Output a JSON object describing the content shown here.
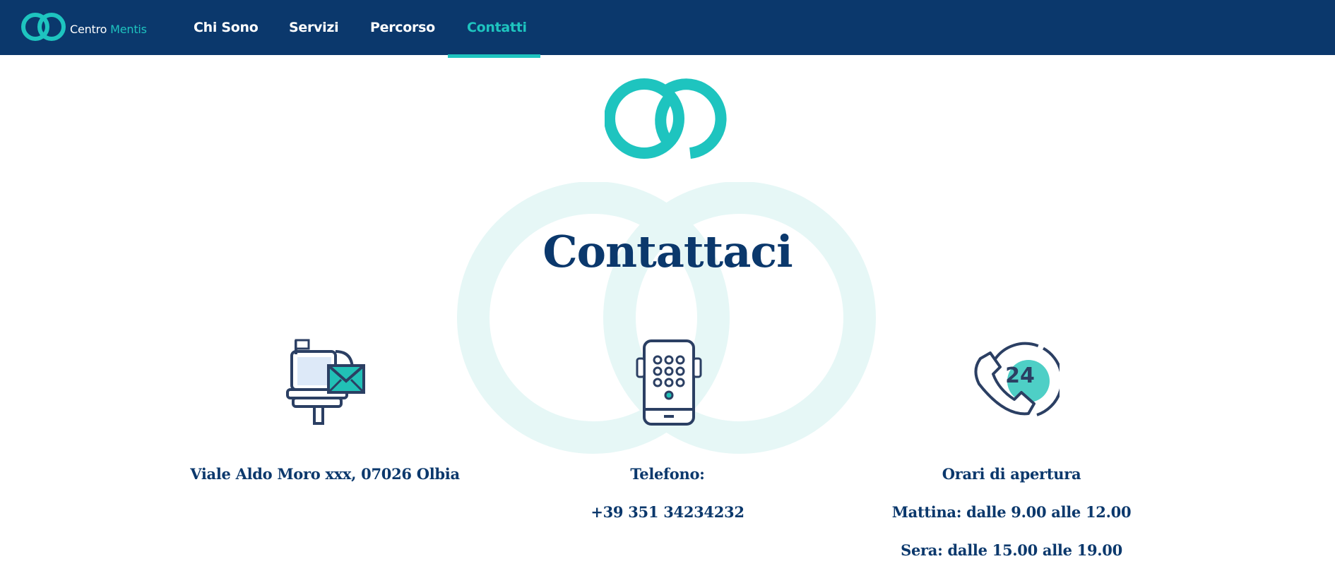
{
  "brand": {
    "name_part1": "Centro",
    "name_part2": "Mentis",
    "logo_icon": "interlocking-rings-icon",
    "accent_color": "#1ec4bf",
    "primary_color": "#0b386c"
  },
  "nav": {
    "items": [
      {
        "label": "Chi Sono",
        "active": false
      },
      {
        "label": "Servizi",
        "active": false
      },
      {
        "label": "Percorso",
        "active": false
      },
      {
        "label": "Contatti",
        "active": true
      }
    ]
  },
  "page": {
    "title": "Contattaci"
  },
  "contacts": {
    "address": {
      "icon": "mailbox-icon",
      "text": "Viale Aldo Moro xxx, 07026 Olbia"
    },
    "phone": {
      "icon": "mobile-phone-icon",
      "label": "Telefono:",
      "number": "+39 351 34234232"
    },
    "hours": {
      "icon": "24h-phone-support-icon",
      "label": "Orari di apertura",
      "morning": "Mattina: dalle 9.00 alle 12.00",
      "evening": "Sera: dalle 15.00 alle 19.00"
    }
  }
}
